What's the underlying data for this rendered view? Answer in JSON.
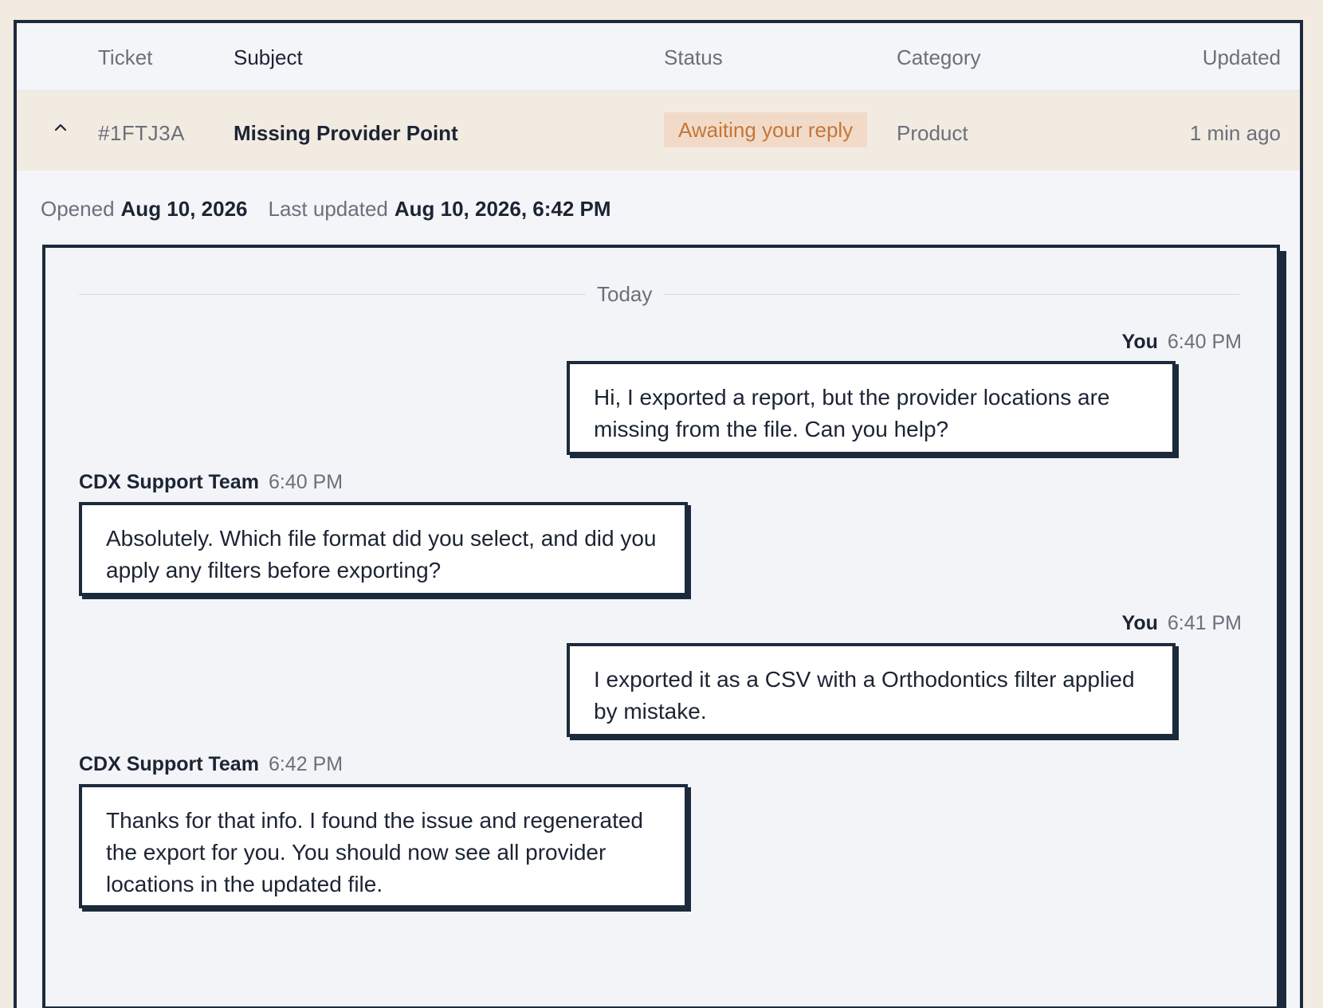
{
  "table": {
    "headers": {
      "ticket": "Ticket",
      "subject": "Subject",
      "status": "Status",
      "category": "Category",
      "updated": "Updated"
    },
    "row": {
      "ticket": "#1FTJ3A",
      "subject": "Missing Provider Point",
      "status": "Awaiting your reply",
      "category": "Product",
      "updated": "1 min ago",
      "expand_icon": "chevron-up-icon"
    }
  },
  "meta": {
    "opened_label": "Opened",
    "opened_value": "Aug 10, 2026",
    "updated_label": "Last updated",
    "updated_value": "Aug 10, 2026, 6:42 PM"
  },
  "conversation": {
    "divider": "Today",
    "messages": [
      {
        "sender": "You",
        "time": "6:40 PM",
        "text": "Hi, I exported a report, but the provider locations are missing from the file. Can you help?"
      },
      {
        "sender": "CDX Support Team",
        "time": "6:40 PM",
        "text": "Absolutely. Which file format did you select, and did you apply any filters before exporting?"
      },
      {
        "sender": "You",
        "time": "6:41 PM",
        "text": "I exported it as a CSV with a Orthodontics filter applied by mistake."
      },
      {
        "sender": "CDX Support Team",
        "time": "6:42 PM",
        "text": "Thanks for that info. I found the issue and regenerated the export for you. You should now see all provider locations in the updated file."
      }
    ]
  },
  "colors": {
    "background": "#f2ebe2",
    "panel": "#f3f5f9",
    "border": "#1c2a3c",
    "status_bg": "#f1dbc8",
    "status_text": "#c4763a",
    "muted_text": "#6a707a"
  }
}
